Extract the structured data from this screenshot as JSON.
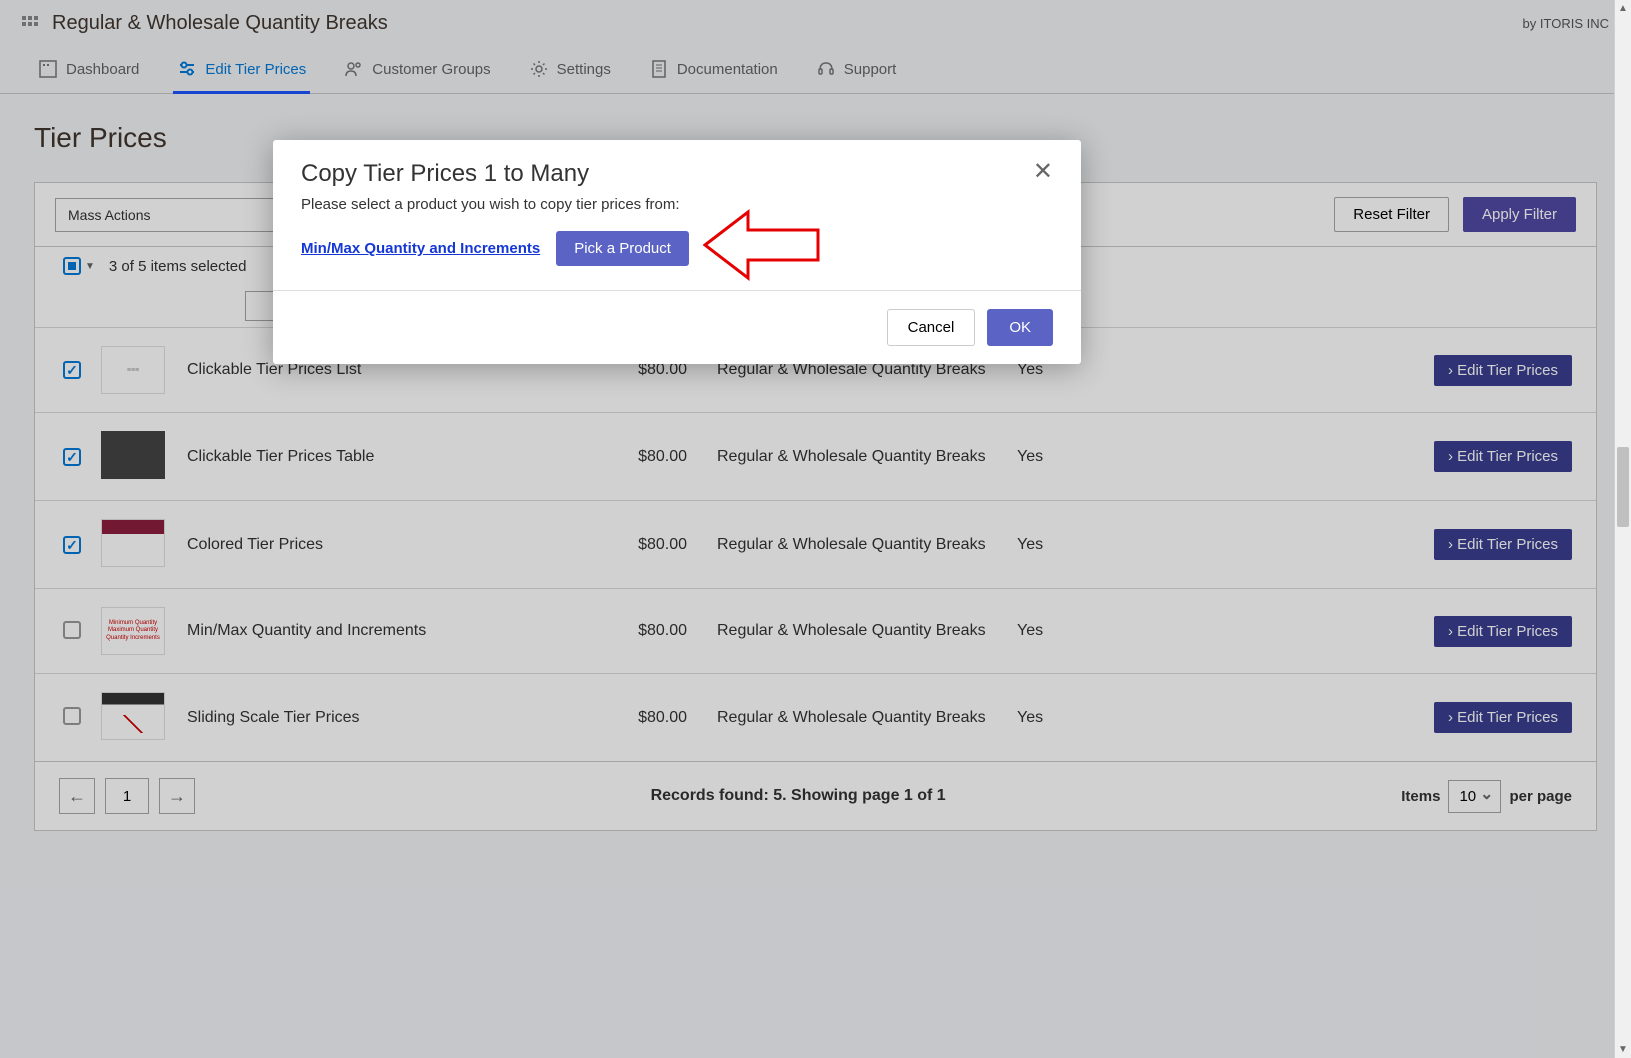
{
  "header": {
    "title": "Regular & Wholesale Quantity Breaks",
    "brand": "by ITORIS INC"
  },
  "nav": {
    "dashboard": "Dashboard",
    "editTier": "Edit Tier Prices",
    "customerGroups": "Customer Groups",
    "settings": "Settings",
    "documentation": "Documentation",
    "support": "Support"
  },
  "page": {
    "title": "Tier Prices",
    "massActions": "Mass Actions",
    "resetFilter": "Reset Filter",
    "applyFilter": "Apply Filter",
    "selectedText": "3 of 5 items selected",
    "editTierBtn": "›  Edit Tier Prices",
    "recordsText": "Records found: 5. Showing page 1 of 1",
    "pageNum": "1",
    "itemsLabel": "Items",
    "perPageLabel": "per page",
    "perPageValue": "10"
  },
  "rows": [
    {
      "checked": true,
      "name": "Clickable Tier Prices List",
      "price": "$80.00",
      "cat": "Regular & Wholesale Quantity Breaks",
      "enabled": "Yes"
    },
    {
      "checked": true,
      "name": "Clickable Tier Prices Table",
      "price": "$80.00",
      "cat": "Regular & Wholesale Quantity Breaks",
      "enabled": "Yes"
    },
    {
      "checked": true,
      "name": "Colored Tier Prices",
      "price": "$80.00",
      "cat": "Regular & Wholesale Quantity Breaks",
      "enabled": "Yes"
    },
    {
      "checked": false,
      "name": "Min/Max Quantity and Increments",
      "price": "$80.00",
      "cat": "Regular & Wholesale Quantity Breaks",
      "enabled": "Yes"
    },
    {
      "checked": false,
      "name": "Sliding Scale Tier Prices",
      "price": "$80.00",
      "cat": "Regular & Wholesale Quantity Breaks",
      "enabled": "Yes"
    }
  ],
  "modal": {
    "title": "Copy Tier Prices 1 to Many",
    "instruction": "Please select a product you wish to copy tier prices from:",
    "productLink": "Min/Max Quantity and Increments",
    "pickBtn": "Pick a Product",
    "cancel": "Cancel",
    "ok": "OK"
  }
}
